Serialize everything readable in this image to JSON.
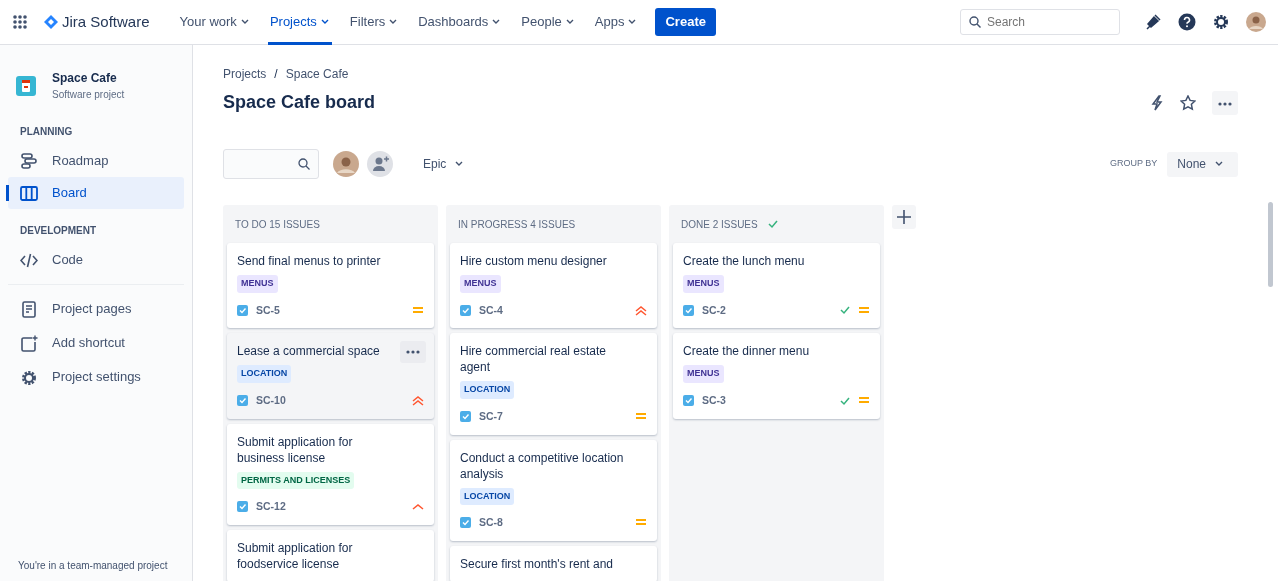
{
  "app": {
    "name": "Jira Software"
  },
  "nav": [
    {
      "label": "Your work",
      "selected": false
    },
    {
      "label": "Projects",
      "selected": true
    },
    {
      "label": "Filters",
      "selected": false
    },
    {
      "label": "Dashboards",
      "selected": false
    },
    {
      "label": "People",
      "selected": false
    },
    {
      "label": "Apps",
      "selected": false
    }
  ],
  "create_button": "Create",
  "search": {
    "placeholder": "Search"
  },
  "project": {
    "name": "Space Cafe",
    "type": "Software project"
  },
  "sidebar": {
    "sections": [
      {
        "heading": "PLANNING",
        "items": [
          {
            "label": "Roadmap",
            "kind": "roadmap",
            "selected": false
          },
          {
            "label": "Board",
            "kind": "board",
            "selected": true
          }
        ]
      },
      {
        "heading": "DEVELOPMENT",
        "items": [
          {
            "label": "Code",
            "kind": "code",
            "selected": false
          }
        ]
      }
    ],
    "links": [
      {
        "label": "Project pages",
        "kind": "pages"
      },
      {
        "label": "Add shortcut",
        "kind": "shortcut"
      },
      {
        "label": "Project settings",
        "kind": "settings"
      }
    ],
    "footer": "You're in a team-managed project"
  },
  "breadcrumbs": [
    "Projects",
    "Space Cafe"
  ],
  "breadcrumb_separator": "/",
  "title": "Space Cafe board",
  "filter": {
    "epic": "Epic",
    "group_by_label": "GROUP BY",
    "group_by": "None"
  },
  "columns": [
    {
      "title": "TO DO 15 ISSUES",
      "done": false,
      "cards": [
        {
          "title": "Send final menus to printer",
          "tag": "MENUS",
          "color": "#403294",
          "key": "SC-5",
          "kind": "medium",
          "done": false,
          "hovered": false
        },
        {
          "title": "Lease a commercial space",
          "tag": "LOCATION",
          "color": "#0747a6",
          "key": "SC-10",
          "kind": "highest",
          "done": false,
          "hovered": true
        },
        {
          "title": "Submit application for business license",
          "tag": "PERMITS AND LICENSES",
          "color": "#006644",
          "key": "SC-12",
          "kind": "high",
          "done": false,
          "hovered": false
        },
        {
          "title": "Submit application for foodservice license",
          "hovered": false
        }
      ]
    },
    {
      "title": "IN PROGRESS 4 ISSUES",
      "done": false,
      "cards": [
        {
          "title": "Hire custom menu designer",
          "tag": "MENUS",
          "color": "#403294",
          "key": "SC-4",
          "kind": "highest",
          "done": false,
          "hovered": false
        },
        {
          "title": "Hire commercial real estate agent",
          "tag": "LOCATION",
          "color": "#0747a6",
          "key": "SC-7",
          "kind": "medium",
          "done": false,
          "hovered": false
        },
        {
          "title": "Conduct a competitive location analysis",
          "tag": "LOCATION",
          "color": "#0747a6",
          "key": "SC-8",
          "kind": "medium",
          "done": false,
          "hovered": false
        },
        {
          "title": "Secure first month's rent and",
          "hovered": false
        }
      ]
    },
    {
      "title": "DONE 2 ISSUES",
      "done": true,
      "cards": [
        {
          "title": "Create the lunch menu",
          "tag": "MENUS",
          "color": "#403294",
          "key": "SC-2",
          "kind": "medium",
          "done": true,
          "hovered": false
        },
        {
          "title": "Create the dinner menu",
          "tag": "MENUS",
          "color": "#403294",
          "key": "SC-3",
          "kind": "medium",
          "done": true,
          "hovered": false
        }
      ]
    }
  ]
}
